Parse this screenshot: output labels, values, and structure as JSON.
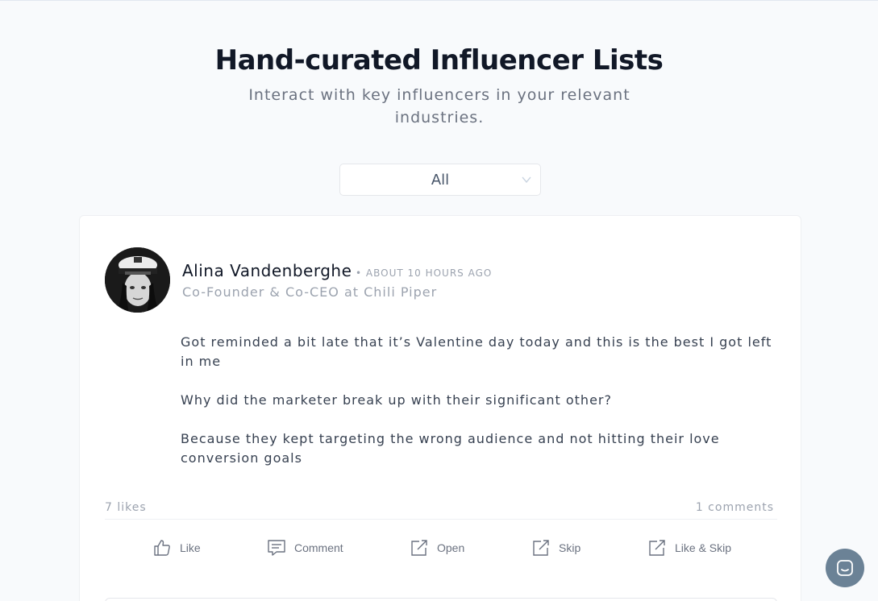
{
  "header": {
    "title": "Hand-curated Influencer Lists",
    "subtitle": "Interact with key influencers in your relevant industries."
  },
  "filter": {
    "selected": "All"
  },
  "post": {
    "author": "Alina Vandenberghe",
    "time": "• ABOUT 10 HOURS AGO",
    "role": "Co-Founder & Co-CEO at Chili Piper",
    "paragraphs": [
      "Got reminded a bit late that it’s Valentine day today and this is the best I got left in me",
      "Why did the marketer break up with their significant other?",
      "Because they kept targeting the wrong audience and not hitting their love conversion goals"
    ],
    "likes": "7 likes",
    "comments": "1 comments"
  },
  "actions": {
    "like": "Like",
    "comment": "Comment",
    "open": "Open",
    "skip": "Skip",
    "like_skip": "Like & Skip"
  },
  "icons": {
    "like": "thumbs-up-icon",
    "comment": "comment-icon",
    "open": "external-link-icon",
    "skip": "external-link-icon",
    "like_skip": "external-link-icon",
    "chat": "chat-bubble-icon"
  },
  "colors": {
    "chat_button": "#6b8296",
    "background": "#f8fafc"
  }
}
